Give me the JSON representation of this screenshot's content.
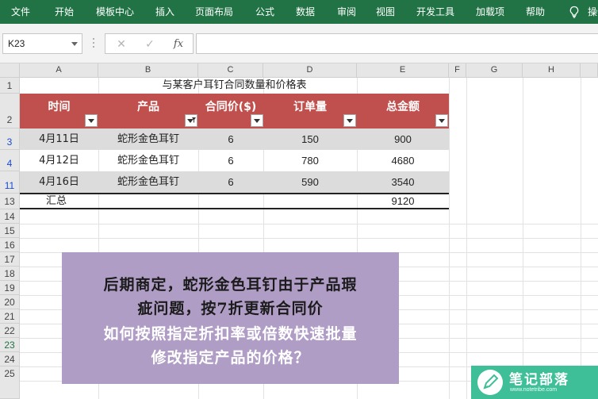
{
  "menu": {
    "items": [
      "文件",
      "开始",
      "模板中心",
      "插入",
      "页面布局",
      "公式",
      "数据",
      "审阅",
      "视图",
      "开发工具",
      "加载项",
      "帮助"
    ],
    "tell_me": "操作说明搜索"
  },
  "formula_bar": {
    "name_box": "K23",
    "cancel_label": "✕",
    "enter_label": "✓",
    "fx_label": "fx",
    "formula": ""
  },
  "columns": [
    "A",
    "B",
    "C",
    "D",
    "E",
    "F",
    "G",
    "H"
  ],
  "rows": [
    "1",
    "2",
    "3",
    "4",
    "11",
    "13",
    "14",
    "15",
    "16",
    "17",
    "18",
    "19",
    "20",
    "21",
    "22",
    "23",
    "24",
    "25"
  ],
  "sheet": {
    "title": "与某客户耳钉合同数量和价格表",
    "headers": [
      "时间",
      "产品",
      "合同价($)",
      "订单量",
      "总金额"
    ],
    "data": [
      [
        "4月11日",
        "蛇形金色耳钉",
        "6",
        "150",
        "900"
      ],
      [
        "4月12日",
        "蛇形金色耳钉",
        "6",
        "780",
        "4680"
      ],
      [
        "4月16日",
        "蛇形金色耳钉",
        "6",
        "590",
        "3540"
      ]
    ],
    "total_label": "汇总",
    "total_value": "9120"
  },
  "note": {
    "line1": "后期商定，蛇形金色耳钉由于产品瑕",
    "line2": "疵问题，按7折更新合同价",
    "line3": "如何按照指定折扣率或倍数快速批量",
    "line4": "修改指定产品的价格？"
  },
  "watermark": {
    "title": "笔记部落",
    "url": "www.notetribe.com"
  },
  "colors": {
    "ribbon": "#217346",
    "header_fill": "#c0504d",
    "band_fill": "#dcdcdc",
    "note_fill": "#b09dc6",
    "logo_fill": "#3fbf97",
    "filtered_row_number": "#1a4bcf"
  }
}
